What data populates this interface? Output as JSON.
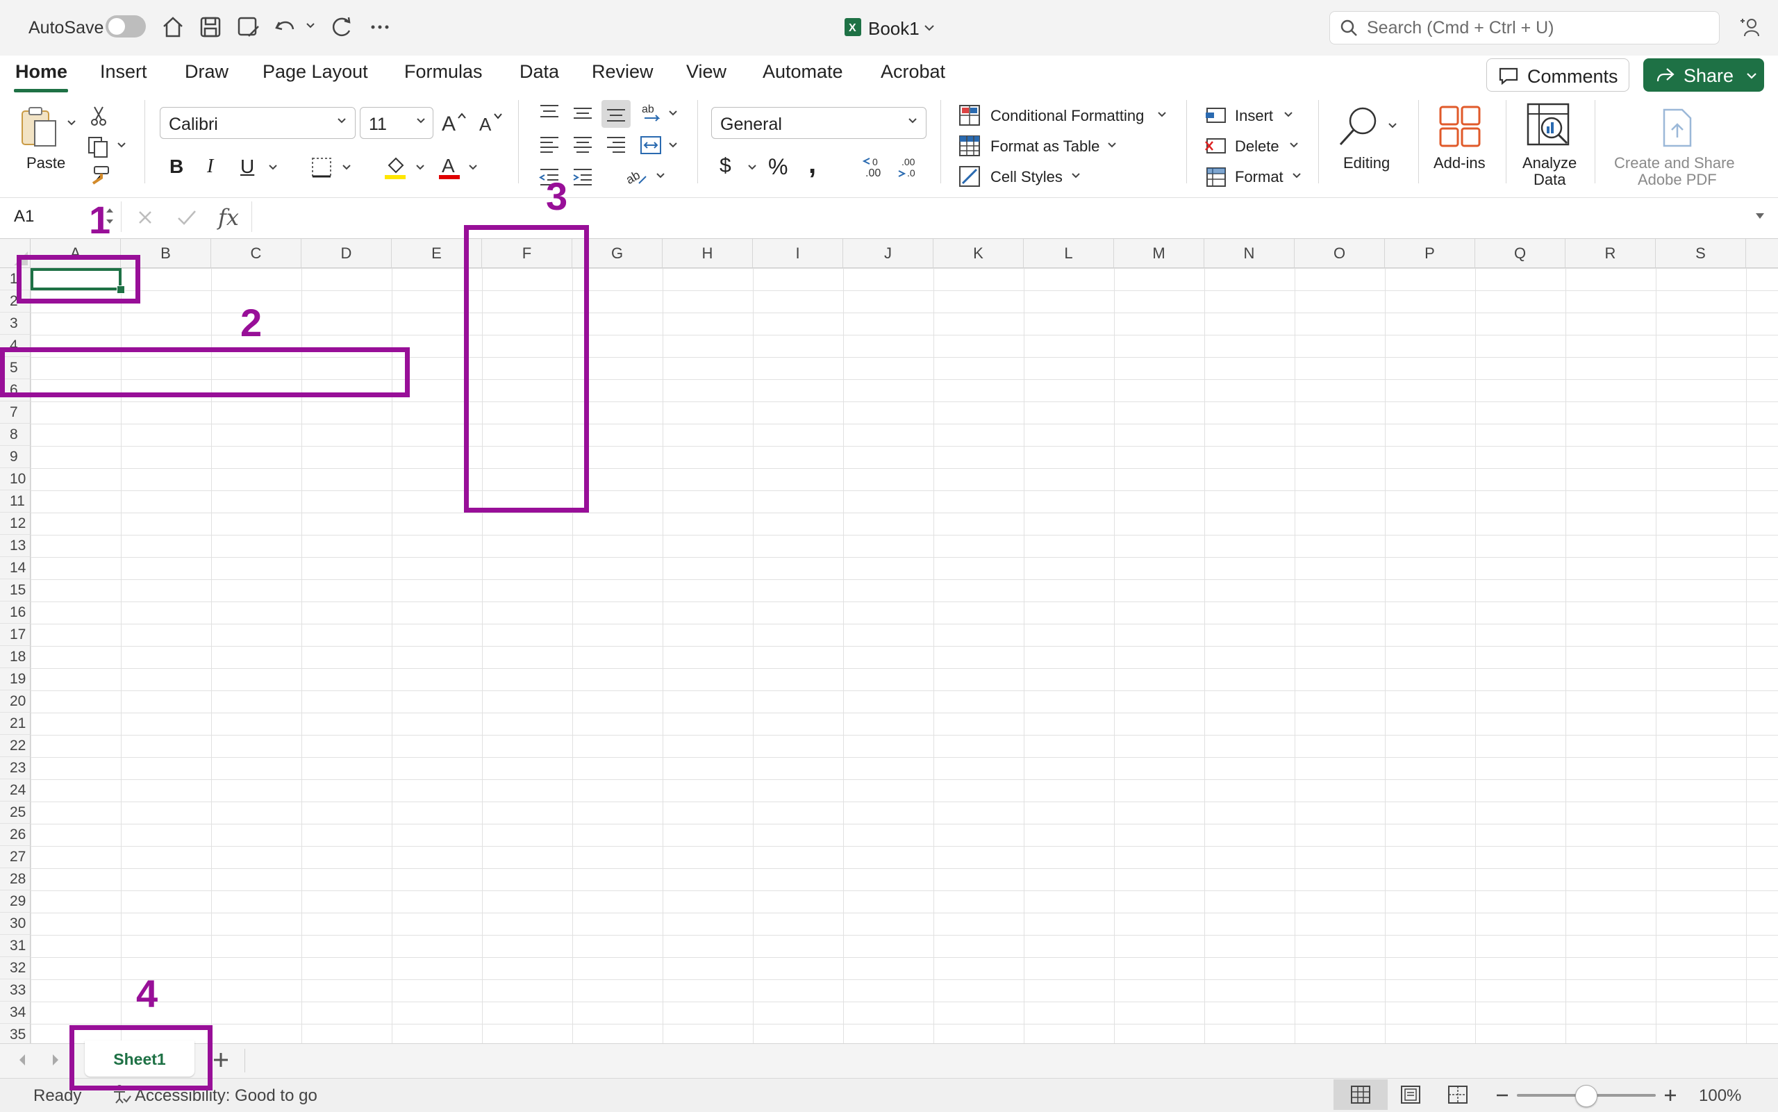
{
  "titlebar": {
    "autosave_label": "AutoSave",
    "doc_title": "Book1",
    "search_placeholder": "Search (Cmd + Ctrl + U)"
  },
  "tabs": [
    "Home",
    "Insert",
    "Draw",
    "Page Layout",
    "Formulas",
    "Data",
    "Review",
    "View",
    "Automate",
    "Acrobat"
  ],
  "active_tab": "Home",
  "buttons": {
    "comments": "Comments",
    "share": "Share"
  },
  "ribbon": {
    "paste": "Paste",
    "font_name": "Calibri",
    "font_size": "11",
    "number_format": "General",
    "conditional_formatting": "Conditional Formatting",
    "format_as_table": "Format as Table",
    "cell_styles": "Cell Styles",
    "insert": "Insert",
    "delete": "Delete",
    "format": "Format",
    "editing": "Editing",
    "add_ins": "Add-ins",
    "analyze_data_1": "Analyze",
    "analyze_data_2": "Data",
    "create_share_1": "Create and Share",
    "create_share_2": "Adobe PDF",
    "bold": "B",
    "italic": "I",
    "underline": "U",
    "percent": "%",
    "comma": ",",
    "dollar": "$"
  },
  "formula_bar": {
    "name_box": "A1",
    "fx": "fx",
    "formula": ""
  },
  "columns": [
    "A",
    "B",
    "C",
    "D",
    "E",
    "F",
    "G",
    "H",
    "I",
    "J",
    "K",
    "L",
    "M",
    "N",
    "O",
    "P",
    "Q",
    "R",
    "S"
  ],
  "rows": [
    "1",
    "2",
    "3",
    "4",
    "5",
    "6",
    "7",
    "8",
    "9",
    "10",
    "11",
    "12",
    "13",
    "14",
    "15",
    "16",
    "17",
    "18",
    "19",
    "20",
    "21",
    "22",
    "23",
    "24",
    "25",
    "26",
    "27",
    "28",
    "29",
    "30",
    "31",
    "32",
    "33",
    "34",
    "35"
  ],
  "annotations": [
    "1",
    "2",
    "3",
    "4"
  ],
  "sheet_tabs": [
    "Sheet1"
  ],
  "status": {
    "ready": "Ready",
    "accessibility": "Accessibility: Good to go",
    "zoom": "100%"
  },
  "colors": {
    "accent": "#1e7145",
    "annotation": "#980f98"
  }
}
